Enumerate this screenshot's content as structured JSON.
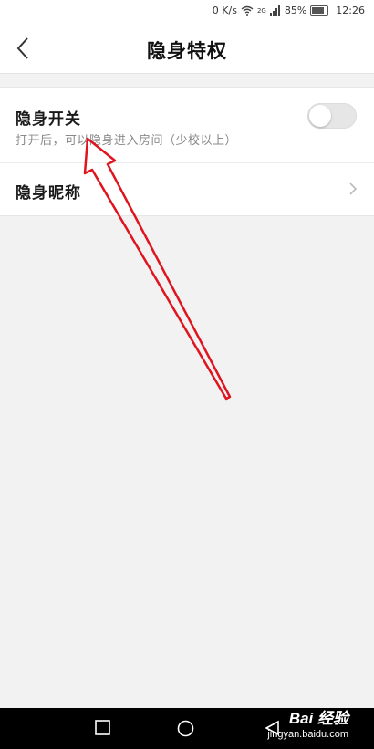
{
  "status_bar": {
    "net_speed": "0 K/s",
    "network_type": "2G",
    "battery": "85%",
    "time": "12:26"
  },
  "header": {
    "title": "隐身特权",
    "back_icon": "chevron-left-icon"
  },
  "settings": {
    "invisible_switch": {
      "title": "隐身开关",
      "description": "打开后，可以隐身进入房间（少校以上）",
      "enabled": false
    },
    "invisible_nickname": {
      "title": "隐身昵称",
      "chevron_icon": "chevron-right-icon"
    }
  },
  "annotation": {
    "arrow_color": "#e0141e"
  },
  "nav_bar": {
    "buttons": [
      "recent-apps-icon",
      "home-icon",
      "back-triangle-icon"
    ]
  },
  "watermark": {
    "brand": "Bai 经验",
    "url": "jingyan.baidu.com"
  }
}
